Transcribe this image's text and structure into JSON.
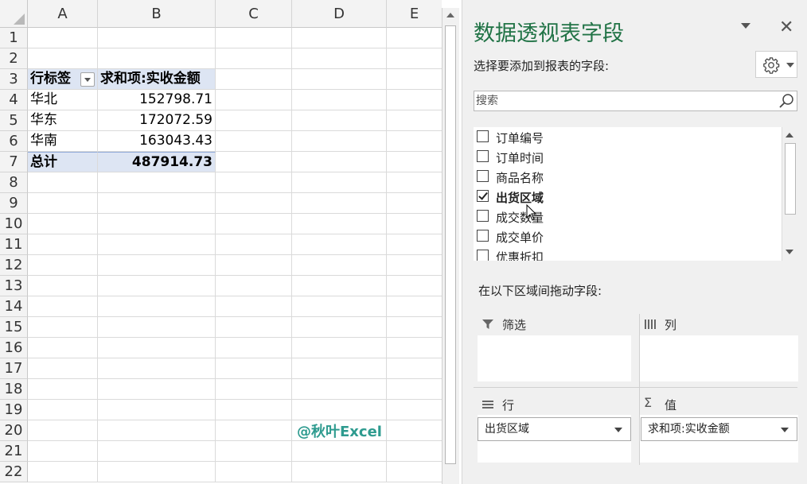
{
  "columns": [
    "A",
    "B",
    "C",
    "D",
    "E"
  ],
  "rows": [
    "1",
    "2",
    "3",
    "4",
    "5",
    "6",
    "7",
    "8",
    "9",
    "10",
    "11",
    "12",
    "13",
    "14",
    "15",
    "16",
    "17",
    "18",
    "19",
    "20",
    "21",
    "22"
  ],
  "pivot": {
    "row_label_header": "行标签",
    "value_header": "求和项:实收金额",
    "rows": [
      {
        "label": "华北",
        "value": "152798.71"
      },
      {
        "label": "华东",
        "value": "172072.59"
      },
      {
        "label": "华南",
        "value": "163043.43"
      }
    ],
    "total_label": "总计",
    "total_value": "487914.73"
  },
  "watermark": "@秋叶Excel",
  "pane": {
    "title": "数据透视表字段",
    "subtitle": "选择要添加到报表的字段:",
    "search_placeholder": "搜索",
    "fields": [
      {
        "label": "订单编号",
        "checked": false
      },
      {
        "label": "订单时间",
        "checked": false
      },
      {
        "label": "商品名称",
        "checked": false
      },
      {
        "label": "出货区域",
        "checked": true
      },
      {
        "label": "成交数量",
        "checked": false
      },
      {
        "label": "成交单价",
        "checked": false
      },
      {
        "label": "优惠折扣",
        "checked": false
      }
    ],
    "drag_label": "在以下区域间拖动字段:",
    "zones": {
      "filter": "筛选",
      "columns": "列",
      "rows": "行",
      "values": "值"
    },
    "row_pill": "出货区域",
    "value_pill": "求和项:实收金额"
  }
}
